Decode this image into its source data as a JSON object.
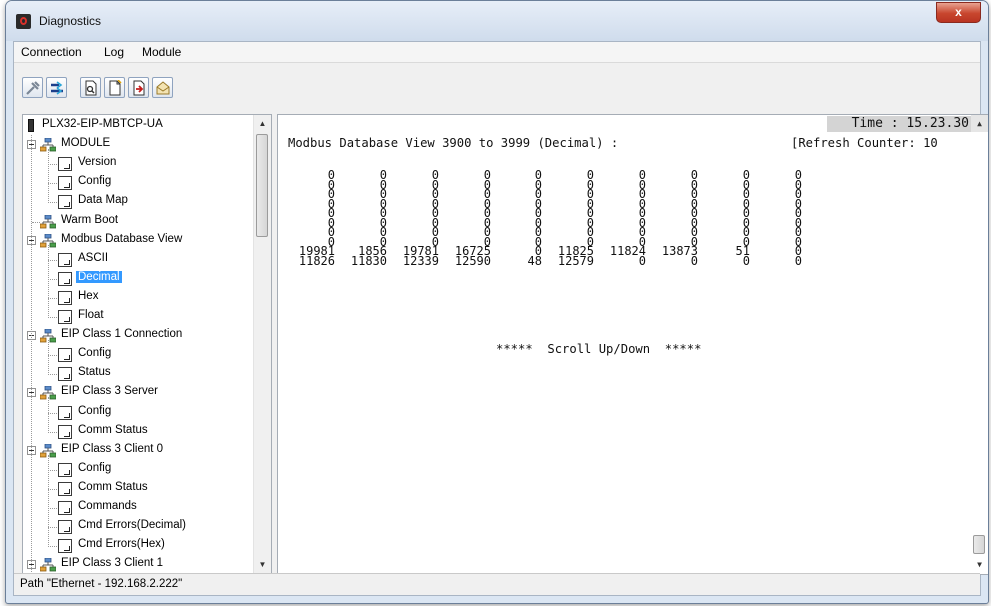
{
  "window": {
    "title": "Diagnostics",
    "close_glyph": "x"
  },
  "menu": [
    "Connection",
    "Log",
    "Module"
  ],
  "toolbar": {
    "buttons": [
      "disconnect-icon",
      "connect-icon",
      "open-log-icon",
      "new-log-icon",
      "save-log-icon",
      "email-log-icon"
    ]
  },
  "tree": {
    "items": [
      {
        "label": "PLX32-EIP-MBTCP-UA",
        "icon": "device-icon",
        "level": 0
      },
      {
        "label": "MODULE",
        "icon": "network-icon",
        "level": 0,
        "expander": true
      },
      {
        "label": "Version",
        "icon": "document-icon",
        "level": 1
      },
      {
        "label": "Config",
        "icon": "document-icon",
        "level": 1
      },
      {
        "label": "Data Map",
        "icon": "document-icon",
        "level": 1
      },
      {
        "label": "Warm Boot",
        "icon": "network-icon",
        "level": 0
      },
      {
        "label": "Modbus Database View",
        "icon": "network-icon",
        "level": 0,
        "expander": true
      },
      {
        "label": "ASCII",
        "icon": "document-icon",
        "level": 1
      },
      {
        "label": "Decimal",
        "icon": "document-icon",
        "level": 1,
        "selected": true
      },
      {
        "label": "Hex",
        "icon": "document-icon",
        "level": 1
      },
      {
        "label": "Float",
        "icon": "document-icon",
        "level": 1
      },
      {
        "label": "EIP Class 1 Connection",
        "icon": "network-icon",
        "level": 0,
        "expander": true
      },
      {
        "label": "Config",
        "icon": "document-icon",
        "level": 1
      },
      {
        "label": "Status",
        "icon": "document-icon",
        "level": 1
      },
      {
        "label": "EIP Class 3 Server",
        "icon": "network-icon",
        "level": 0,
        "expander": true
      },
      {
        "label": "Config",
        "icon": "document-icon",
        "level": 1
      },
      {
        "label": "Comm Status",
        "icon": "document-icon",
        "level": 1
      },
      {
        "label": "EIP Class 3 Client 0",
        "icon": "network-icon",
        "level": 0,
        "expander": true
      },
      {
        "label": "Config",
        "icon": "document-icon",
        "level": 1
      },
      {
        "label": "Comm Status",
        "icon": "document-icon",
        "level": 1
      },
      {
        "label": "Commands",
        "icon": "document-icon",
        "level": 1
      },
      {
        "label": "Cmd Errors(Decimal)",
        "icon": "document-icon",
        "level": 1
      },
      {
        "label": "Cmd Errors(Hex)",
        "icon": "document-icon",
        "level": 1
      },
      {
        "label": "EIP Class 3 Client 1",
        "icon": "network-icon",
        "level": 0,
        "expander": true
      }
    ]
  },
  "data_view": {
    "time": "Time : 15.23.30",
    "heading": "Modbus Database View 3900 to 3999 (Decimal) :",
    "refresh": "[Refresh Counter: 10",
    "scroll_hint": "*****  Scroll Up/Down  *****",
    "rows": [
      [
        "0",
        "0",
        "0",
        "0",
        "0",
        "0",
        "0",
        "0",
        "0",
        "0"
      ],
      [
        "0",
        "0",
        "0",
        "0",
        "0",
        "0",
        "0",
        "0",
        "0",
        "0"
      ],
      [
        "0",
        "0",
        "0",
        "0",
        "0",
        "0",
        "0",
        "0",
        "0",
        "0"
      ],
      [
        "0",
        "0",
        "0",
        "0",
        "0",
        "0",
        "0",
        "0",
        "0",
        "0"
      ],
      [
        "0",
        "0",
        "0",
        "0",
        "0",
        "0",
        "0",
        "0",
        "0",
        "0"
      ],
      [
        "0",
        "0",
        "0",
        "0",
        "0",
        "0",
        "0",
        "0",
        "0",
        "0"
      ],
      [
        "0",
        "0",
        "0",
        "0",
        "0",
        "0",
        "0",
        "0",
        "0",
        "0"
      ],
      [
        "0",
        "0",
        "0",
        "0",
        "0",
        "0",
        "0",
        "0",
        "0",
        "0"
      ],
      [
        "19981",
        "1856",
        "19781",
        "16725",
        "0",
        "11825",
        "11824",
        "13873",
        "51",
        "0"
      ],
      [
        "11826",
        "11830",
        "12339",
        "12590",
        "48",
        "12579",
        "0",
        "0",
        "0",
        "0"
      ]
    ]
  },
  "status": {
    "path": "Path \"Ethernet - 192.168.2.222\""
  }
}
